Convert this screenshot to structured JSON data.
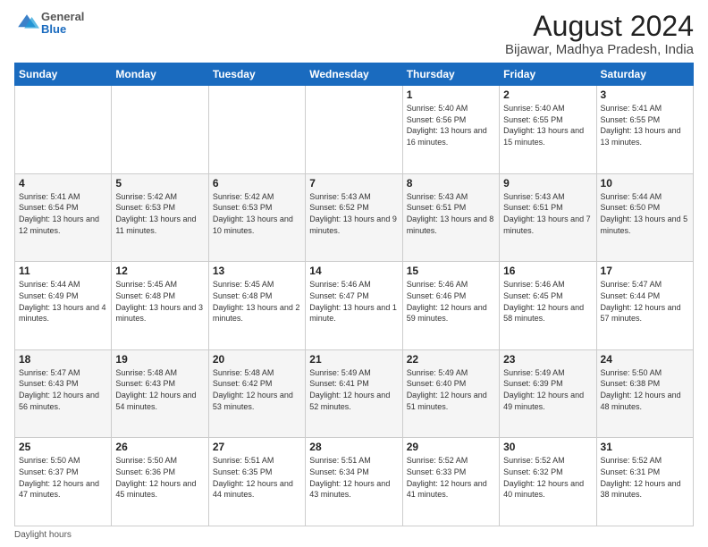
{
  "header": {
    "logo": {
      "general": "General",
      "blue": "Blue"
    },
    "title": "August 2024",
    "subtitle": "Bijawar, Madhya Pradesh, India"
  },
  "days_of_week": [
    "Sunday",
    "Monday",
    "Tuesday",
    "Wednesday",
    "Thursday",
    "Friday",
    "Saturday"
  ],
  "weeks": [
    [
      {
        "day": "",
        "info": ""
      },
      {
        "day": "",
        "info": ""
      },
      {
        "day": "",
        "info": ""
      },
      {
        "day": "",
        "info": ""
      },
      {
        "day": "1",
        "info": "Sunrise: 5:40 AM\nSunset: 6:56 PM\nDaylight: 13 hours\nand 16 minutes."
      },
      {
        "day": "2",
        "info": "Sunrise: 5:40 AM\nSunset: 6:55 PM\nDaylight: 13 hours\nand 15 minutes."
      },
      {
        "day": "3",
        "info": "Sunrise: 5:41 AM\nSunset: 6:55 PM\nDaylight: 13 hours\nand 13 minutes."
      }
    ],
    [
      {
        "day": "4",
        "info": "Sunrise: 5:41 AM\nSunset: 6:54 PM\nDaylight: 13 hours\nand 12 minutes."
      },
      {
        "day": "5",
        "info": "Sunrise: 5:42 AM\nSunset: 6:53 PM\nDaylight: 13 hours\nand 11 minutes."
      },
      {
        "day": "6",
        "info": "Sunrise: 5:42 AM\nSunset: 6:53 PM\nDaylight: 13 hours\nand 10 minutes."
      },
      {
        "day": "7",
        "info": "Sunrise: 5:43 AM\nSunset: 6:52 PM\nDaylight: 13 hours\nand 9 minutes."
      },
      {
        "day": "8",
        "info": "Sunrise: 5:43 AM\nSunset: 6:51 PM\nDaylight: 13 hours\nand 8 minutes."
      },
      {
        "day": "9",
        "info": "Sunrise: 5:43 AM\nSunset: 6:51 PM\nDaylight: 13 hours\nand 7 minutes."
      },
      {
        "day": "10",
        "info": "Sunrise: 5:44 AM\nSunset: 6:50 PM\nDaylight: 13 hours\nand 5 minutes."
      }
    ],
    [
      {
        "day": "11",
        "info": "Sunrise: 5:44 AM\nSunset: 6:49 PM\nDaylight: 13 hours\nand 4 minutes."
      },
      {
        "day": "12",
        "info": "Sunrise: 5:45 AM\nSunset: 6:48 PM\nDaylight: 13 hours\nand 3 minutes."
      },
      {
        "day": "13",
        "info": "Sunrise: 5:45 AM\nSunset: 6:48 PM\nDaylight: 13 hours\nand 2 minutes."
      },
      {
        "day": "14",
        "info": "Sunrise: 5:46 AM\nSunset: 6:47 PM\nDaylight: 13 hours\nand 1 minute."
      },
      {
        "day": "15",
        "info": "Sunrise: 5:46 AM\nSunset: 6:46 PM\nDaylight: 12 hours\nand 59 minutes."
      },
      {
        "day": "16",
        "info": "Sunrise: 5:46 AM\nSunset: 6:45 PM\nDaylight: 12 hours\nand 58 minutes."
      },
      {
        "day": "17",
        "info": "Sunrise: 5:47 AM\nSunset: 6:44 PM\nDaylight: 12 hours\nand 57 minutes."
      }
    ],
    [
      {
        "day": "18",
        "info": "Sunrise: 5:47 AM\nSunset: 6:43 PM\nDaylight: 12 hours\nand 56 minutes."
      },
      {
        "day": "19",
        "info": "Sunrise: 5:48 AM\nSunset: 6:43 PM\nDaylight: 12 hours\nand 54 minutes."
      },
      {
        "day": "20",
        "info": "Sunrise: 5:48 AM\nSunset: 6:42 PM\nDaylight: 12 hours\nand 53 minutes."
      },
      {
        "day": "21",
        "info": "Sunrise: 5:49 AM\nSunset: 6:41 PM\nDaylight: 12 hours\nand 52 minutes."
      },
      {
        "day": "22",
        "info": "Sunrise: 5:49 AM\nSunset: 6:40 PM\nDaylight: 12 hours\nand 51 minutes."
      },
      {
        "day": "23",
        "info": "Sunrise: 5:49 AM\nSunset: 6:39 PM\nDaylight: 12 hours\nand 49 minutes."
      },
      {
        "day": "24",
        "info": "Sunrise: 5:50 AM\nSunset: 6:38 PM\nDaylight: 12 hours\nand 48 minutes."
      }
    ],
    [
      {
        "day": "25",
        "info": "Sunrise: 5:50 AM\nSunset: 6:37 PM\nDaylight: 12 hours\nand 47 minutes."
      },
      {
        "day": "26",
        "info": "Sunrise: 5:50 AM\nSunset: 6:36 PM\nDaylight: 12 hours\nand 45 minutes."
      },
      {
        "day": "27",
        "info": "Sunrise: 5:51 AM\nSunset: 6:35 PM\nDaylight: 12 hours\nand 44 minutes."
      },
      {
        "day": "28",
        "info": "Sunrise: 5:51 AM\nSunset: 6:34 PM\nDaylight: 12 hours\nand 43 minutes."
      },
      {
        "day": "29",
        "info": "Sunrise: 5:52 AM\nSunset: 6:33 PM\nDaylight: 12 hours\nand 41 minutes."
      },
      {
        "day": "30",
        "info": "Sunrise: 5:52 AM\nSunset: 6:32 PM\nDaylight: 12 hours\nand 40 minutes."
      },
      {
        "day": "31",
        "info": "Sunrise: 5:52 AM\nSunset: 6:31 PM\nDaylight: 12 hours\nand 38 minutes."
      }
    ]
  ],
  "footer": {
    "daylight_label": "Daylight hours"
  }
}
